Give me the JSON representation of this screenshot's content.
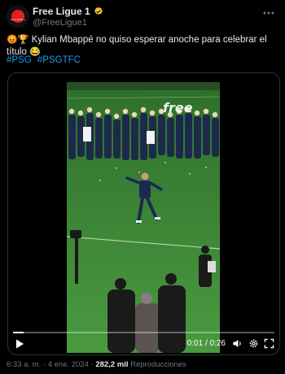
{
  "account": {
    "name": "Free Ligue 1",
    "handle": "@FreeLigue1",
    "avatar_text": "free LIGUE 1",
    "verified": true
  },
  "tweet": {
    "emoji_prefix": "😡🏆",
    "text": "Kylian Mbappé no quiso esperar anoche para celebrar el título",
    "emoji_suffix": "😂",
    "hashtags": [
      "#PSG",
      "#PSGTFC"
    ]
  },
  "video": {
    "watermark": "free",
    "current_time": "0:01",
    "duration": "0:26",
    "progress_fraction": 0.04
  },
  "meta": {
    "time": "6:33 a. m.",
    "separator": "·",
    "date": "4 ene. 2024",
    "views_count": "282,2 mil",
    "views_label": "Reproducciones"
  },
  "icons": {
    "verified": "verified-badge-icon",
    "more": "more-options-icon",
    "play": "play-icon",
    "volume": "volume-icon",
    "settings": "settings-gear-icon",
    "fullscreen": "fullscreen-icon"
  },
  "colors": {
    "background": "#000000",
    "text": "#e7e9ea",
    "secondary": "#71767b",
    "link": "#1d9bf0",
    "verified": "#f4c430",
    "pitch": "#3f8d3a"
  }
}
